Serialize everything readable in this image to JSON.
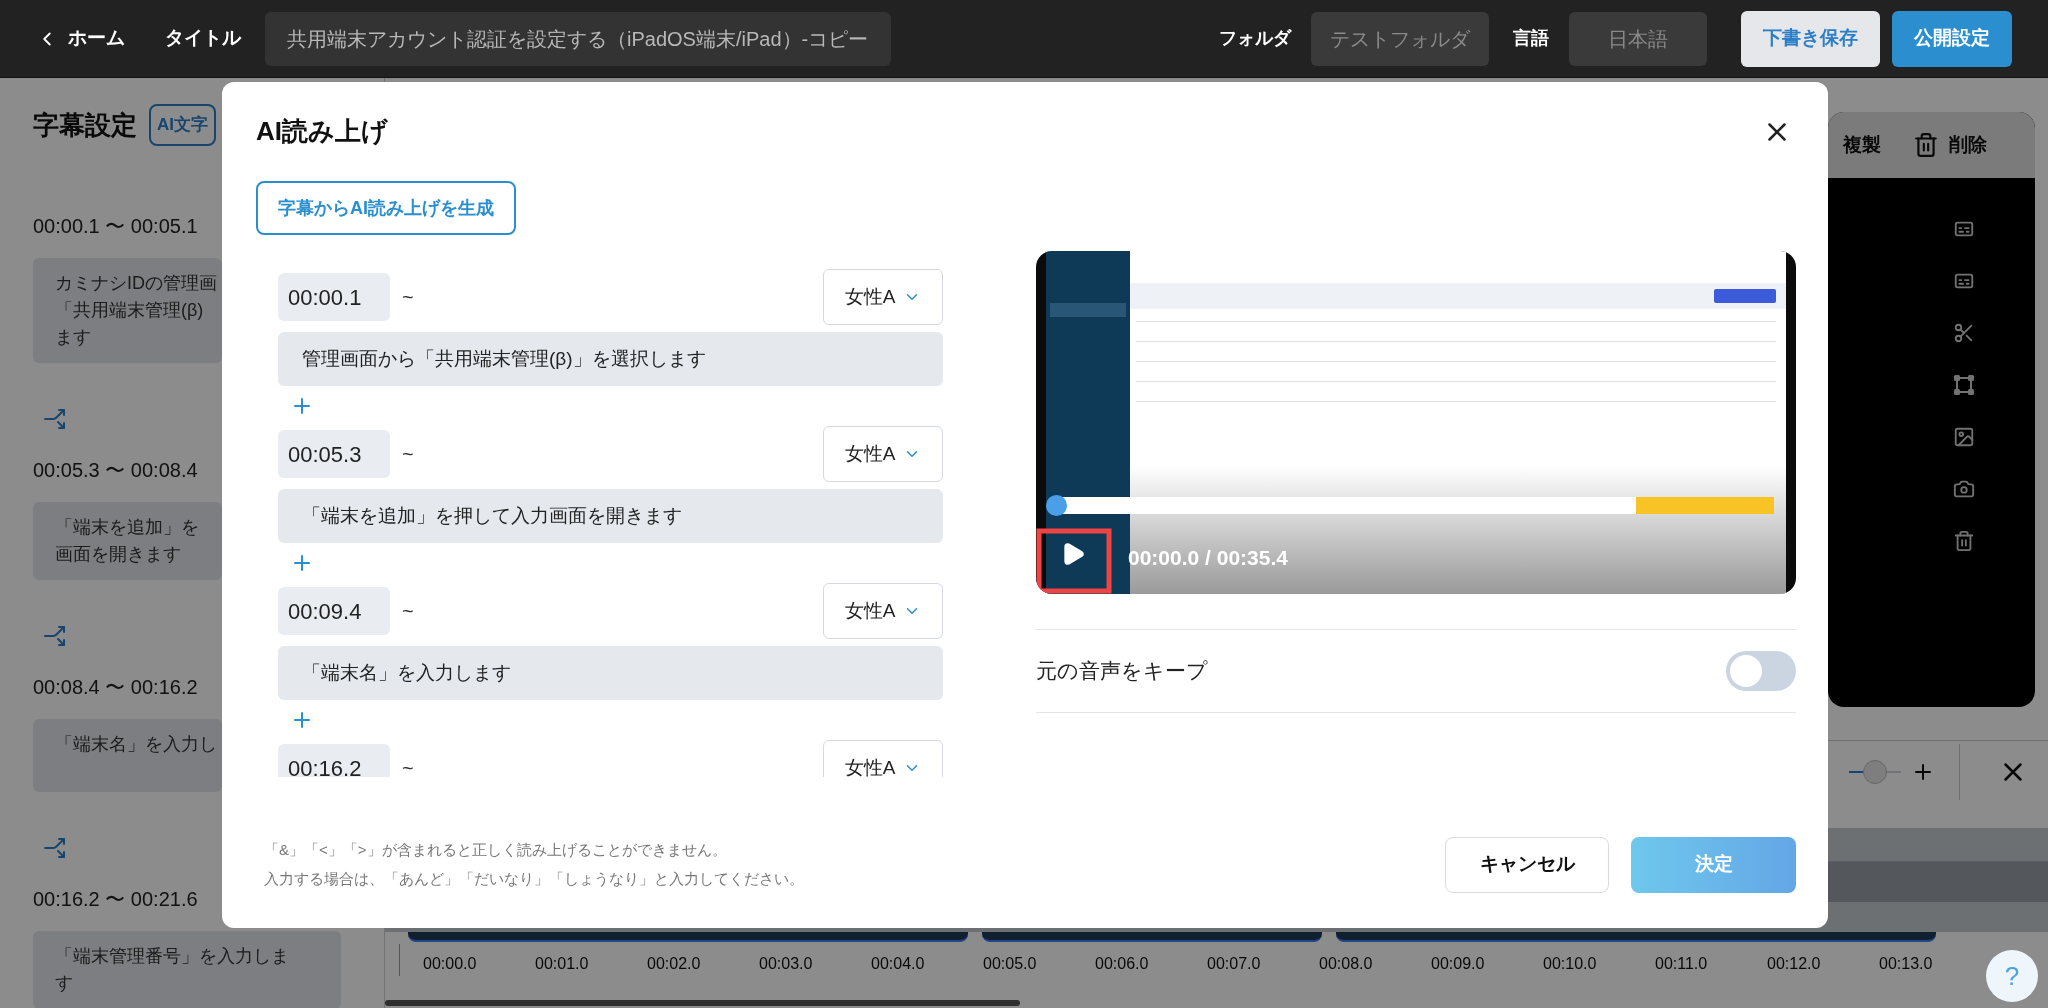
{
  "top_bar": {
    "back_label": "ホーム",
    "title_label": "タイトル",
    "title_value": "共用端末アカウント認証を設定する（iPadOS端末/iPad）-コピー",
    "folder_label": "フォルダ",
    "folder_value": "テストフォルダ",
    "language_label": "言語",
    "language_value": "日本語",
    "buttons": [
      {
        "label": "下書き保存",
        "kind": "draft"
      },
      {
        "label": "公開設定",
        "kind": "publish"
      }
    ]
  },
  "subtitle_panel": {
    "title": "字幕設定",
    "ai_button": "AI文字",
    "entries": [
      {
        "time": "00:00.1 〜 00:05.1",
        "lines": [
          "カミナシIDの管理画",
          "「共用端末管理(β)",
          "ます"
        ]
      },
      {
        "time": "00:05.3 〜 00:08.4",
        "lines": [
          "「端末を追加」を",
          "画面を開きます"
        ]
      },
      {
        "time": "00:08.4 〜 00:16.2",
        "lines": [
          "「端末名」を入力し"
        ]
      },
      {
        "time": "00:16.2 〜 00:21.6",
        "lines": [
          "「端末管理番号」を入力しま",
          "す"
        ]
      }
    ]
  },
  "preview_panel": {
    "duplicate": "複製",
    "delete": "削除"
  },
  "help_button": "?",
  "zoom": {
    "level": 0.5
  },
  "timeline": {
    "ticks": [
      "00:00.0",
      "00:01.0",
      "00:02.0",
      "00:03.0",
      "00:04.0",
      "00:05.0",
      "00:06.0",
      "00:07.0",
      "00:08.0",
      "00:09.0",
      "00:10.0",
      "00:11.0",
      "00:12.0",
      "00:13.0"
    ]
  },
  "dialog": {
    "title": "AI読み上げ",
    "generate_button": "字幕からAI読み上げを生成",
    "lines": [
      {
        "time": "00:00.1",
        "separator": "~",
        "voice": "女性A",
        "text": "管理画面から「共用端末管理(β)」を選択します"
      },
      {
        "time": "00:05.3",
        "separator": "~",
        "voice": "女性A",
        "text": "「端末を追加」を押して入力画面を開きます"
      },
      {
        "time": "00:09.4",
        "separator": "~",
        "voice": "女性A",
        "text": "「端末名」を入力します"
      },
      {
        "time": "00:16.2",
        "separator": "~",
        "voice": "女性A"
      }
    ],
    "notes": [
      "「&」「<」「>」が含まれると正しく読み上げることができません。",
      "入力する場合は、「あんど」「だいなり」「しょうなり」と入力してください。"
    ],
    "player": {
      "time": "00:00.0 / 00:35.4",
      "level": 0,
      "end_segment": {
        "level": 0.19
      }
    },
    "keep_original_audio": {
      "label": "元の音声をキープ",
      "on": false
    },
    "buttons": [
      {
        "label": "キャンセル",
        "kind": "cancel"
      },
      {
        "label": "決定",
        "kind": "confirm"
      }
    ]
  }
}
